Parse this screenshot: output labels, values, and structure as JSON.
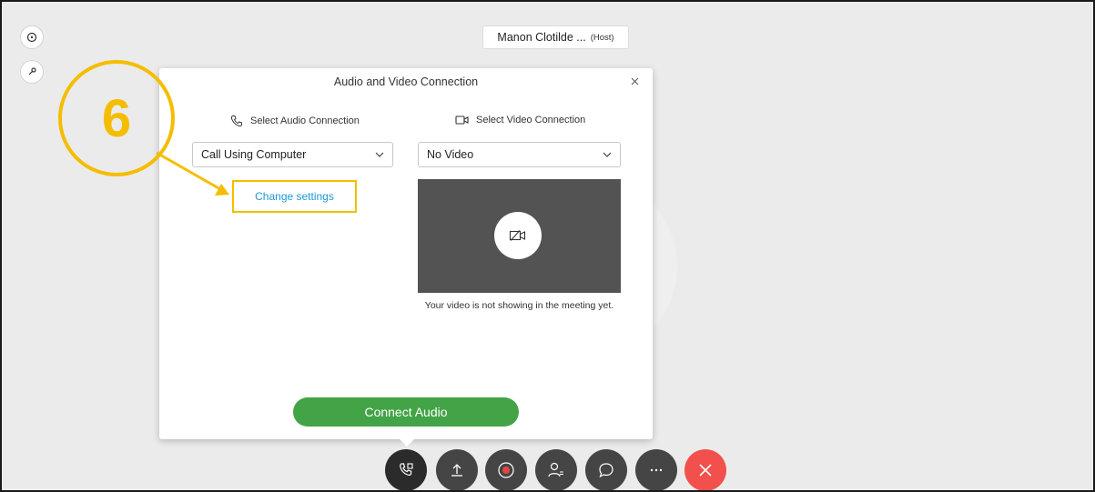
{
  "host": {
    "name": "Manon Clotilde ...",
    "tag": "(Host)"
  },
  "side_buttons": [
    {
      "icon": "info-icon"
    },
    {
      "icon": "key-icon"
    }
  ],
  "dialog": {
    "title": "Audio and Video Connection",
    "close_icon": "close-icon",
    "audio": {
      "heading": "Select Audio Connection",
      "icon": "phone-icon",
      "selected": "Call Using Computer",
      "change_settings": "Change settings"
    },
    "video": {
      "heading": "Select Video Connection",
      "icon": "video-camera-icon",
      "selected": "No Video",
      "preview_icon": "video-off-icon",
      "note": "Your video is not showing in the meeting yet."
    },
    "connect_label": "Connect Audio"
  },
  "annotation": {
    "step": "6"
  },
  "toolbar": [
    {
      "name": "audio-connection-button",
      "icon": "phone-settings-icon"
    },
    {
      "name": "share-button",
      "icon": "upload-icon"
    },
    {
      "name": "record-button",
      "icon": "record-icon"
    },
    {
      "name": "participants-button",
      "icon": "participants-icon"
    },
    {
      "name": "chat-button",
      "icon": "chat-icon"
    },
    {
      "name": "more-options-button",
      "icon": "more-icon"
    },
    {
      "name": "leave-meeting-button",
      "icon": "close-icon"
    }
  ],
  "colors": {
    "accent_yellow": "#f5bd00",
    "link_blue": "#1a9ad6",
    "connect_green": "#43a447",
    "end_red": "#f2504c",
    "toolbar_gray": "#454545"
  }
}
